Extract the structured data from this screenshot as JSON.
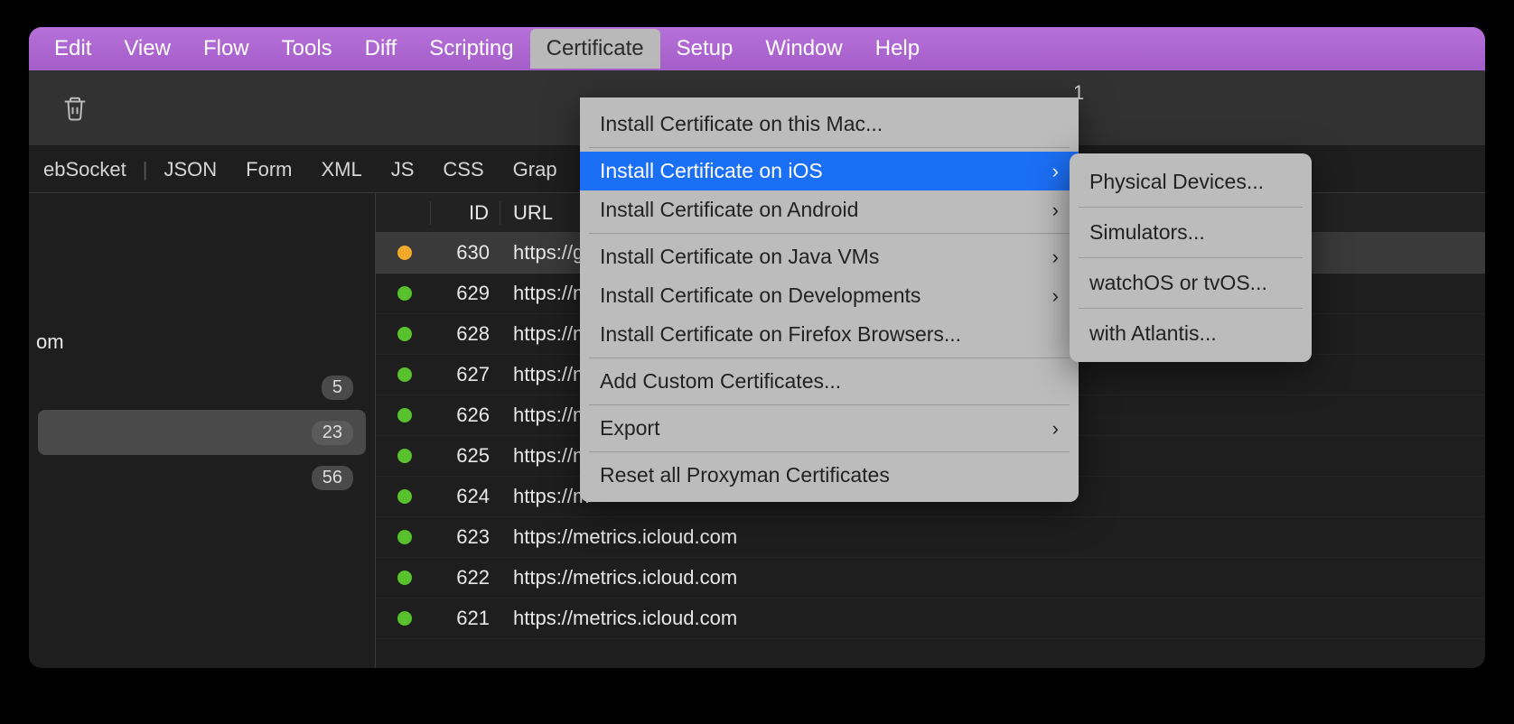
{
  "menubar": {
    "items": [
      "Edit",
      "View",
      "Flow",
      "Tools",
      "Diff",
      "Scripting",
      "Certificate",
      "Setup",
      "Window",
      "Help"
    ],
    "active_index": 6
  },
  "toolbar": {
    "extra_text": "1"
  },
  "filterbar": {
    "items": [
      "ebSocket",
      "JSON",
      "Form",
      "XML",
      "JS",
      "CSS",
      "Grap"
    ]
  },
  "sidebar": {
    "rows": [
      {
        "label": "om",
        "badge": ""
      },
      {
        "label": "",
        "badge": "5"
      },
      {
        "label": "",
        "badge": "23",
        "selected": true
      },
      {
        "label": "",
        "badge": "56"
      }
    ]
  },
  "table": {
    "headers": {
      "id": "ID",
      "url": "URL"
    },
    "rows": [
      {
        "status": "orange",
        "id": "630",
        "url": "https://g",
        "highlight": true
      },
      {
        "status": "green",
        "id": "629",
        "url": "https://m"
      },
      {
        "status": "green",
        "id": "628",
        "url": "https://m"
      },
      {
        "status": "green",
        "id": "627",
        "url": "https://m"
      },
      {
        "status": "green",
        "id": "626",
        "url": "https://m"
      },
      {
        "status": "green",
        "id": "625",
        "url": "https://m"
      },
      {
        "status": "green",
        "id": "624",
        "url": "https://m"
      },
      {
        "status": "green",
        "id": "623",
        "url": "https://metrics.icloud.com"
      },
      {
        "status": "green",
        "id": "622",
        "url": "https://metrics.icloud.com"
      },
      {
        "status": "green",
        "id": "621",
        "url": "https://metrics.icloud.com"
      }
    ]
  },
  "dropdown": {
    "items": [
      {
        "label": "Install Certificate on this Mac...",
        "arrow": false
      },
      {
        "sep": true
      },
      {
        "label": "Install Certificate on iOS",
        "arrow": true,
        "highlight": true
      },
      {
        "label": "Install Certificate on Android",
        "arrow": true
      },
      {
        "sep": true
      },
      {
        "label": "Install Certificate on Java VMs",
        "arrow": true
      },
      {
        "label": "Install Certificate on Developments",
        "arrow": true
      },
      {
        "label": "Install Certificate on Firefox Browsers...",
        "arrow": false
      },
      {
        "sep": true
      },
      {
        "label": "Add Custom Certificates...",
        "arrow": false
      },
      {
        "sep": true
      },
      {
        "label": "Export",
        "arrow": true
      },
      {
        "sep": true
      },
      {
        "label": "Reset all Proxyman Certificates",
        "arrow": false
      }
    ]
  },
  "submenu": {
    "items": [
      {
        "label": "Physical Devices..."
      },
      {
        "sep": true
      },
      {
        "label": "Simulators..."
      },
      {
        "sep": true
      },
      {
        "label": "watchOS or tvOS..."
      },
      {
        "sep": true
      },
      {
        "label": "with Atlantis..."
      }
    ]
  }
}
